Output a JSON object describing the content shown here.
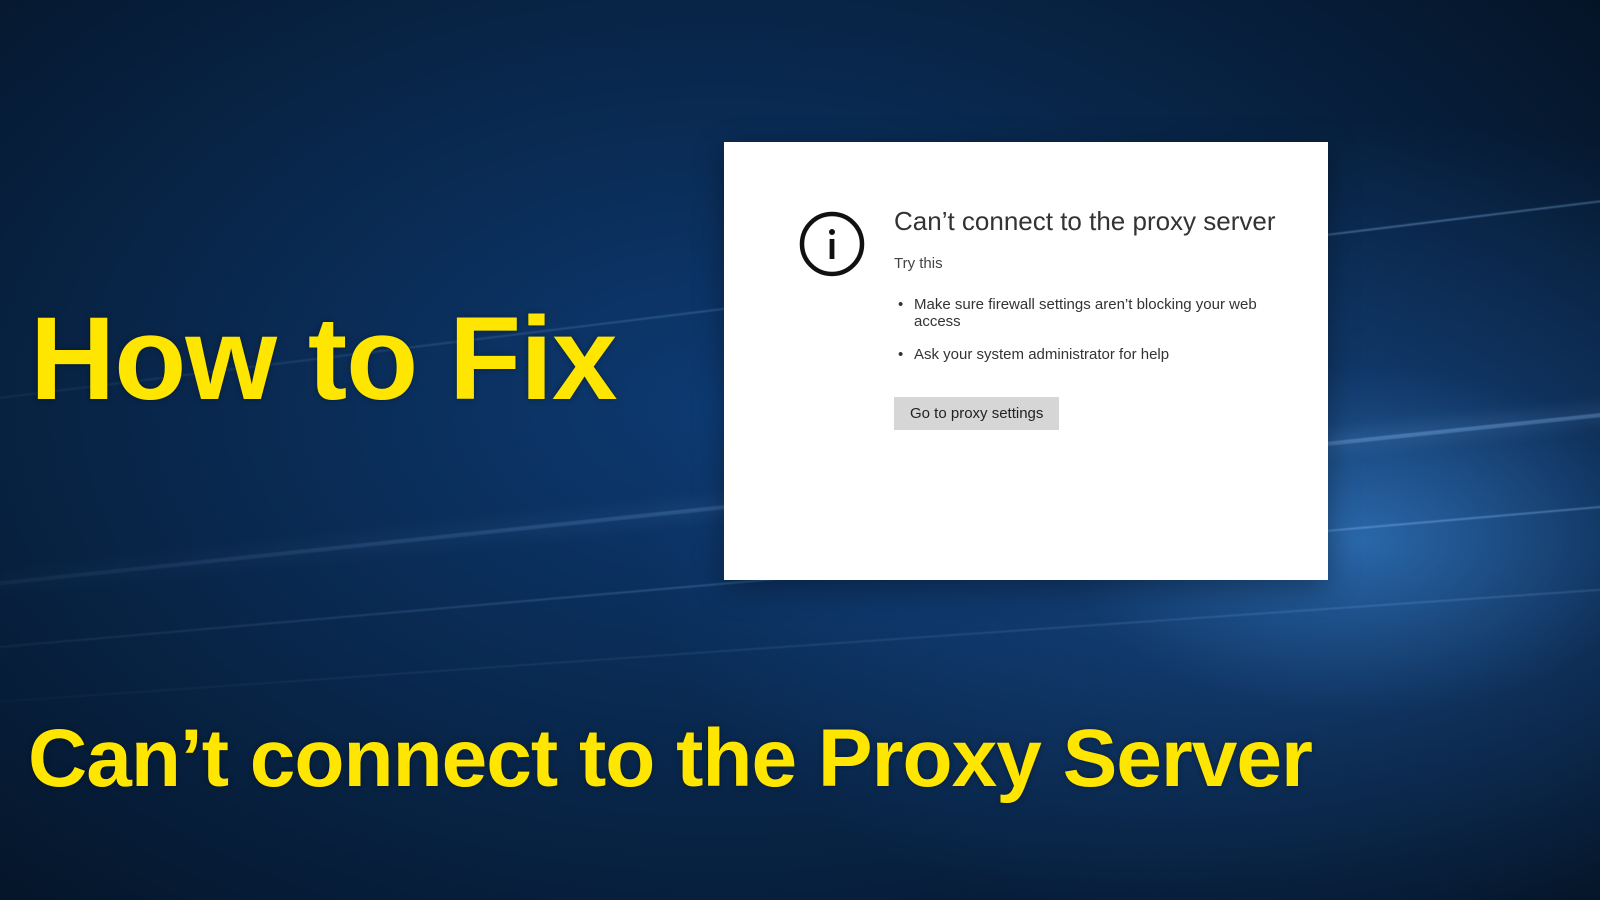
{
  "headline": {
    "top": "How to Fix",
    "bottom": "Can’t connect to the Proxy Server"
  },
  "error_card": {
    "title": "Can’t connect to the proxy server",
    "subtitle": "Try this",
    "bullets": [
      "Make sure firewall settings aren’t blocking your web access",
      "Ask your system administrator for help"
    ],
    "button_label": "Go to proxy settings"
  }
}
